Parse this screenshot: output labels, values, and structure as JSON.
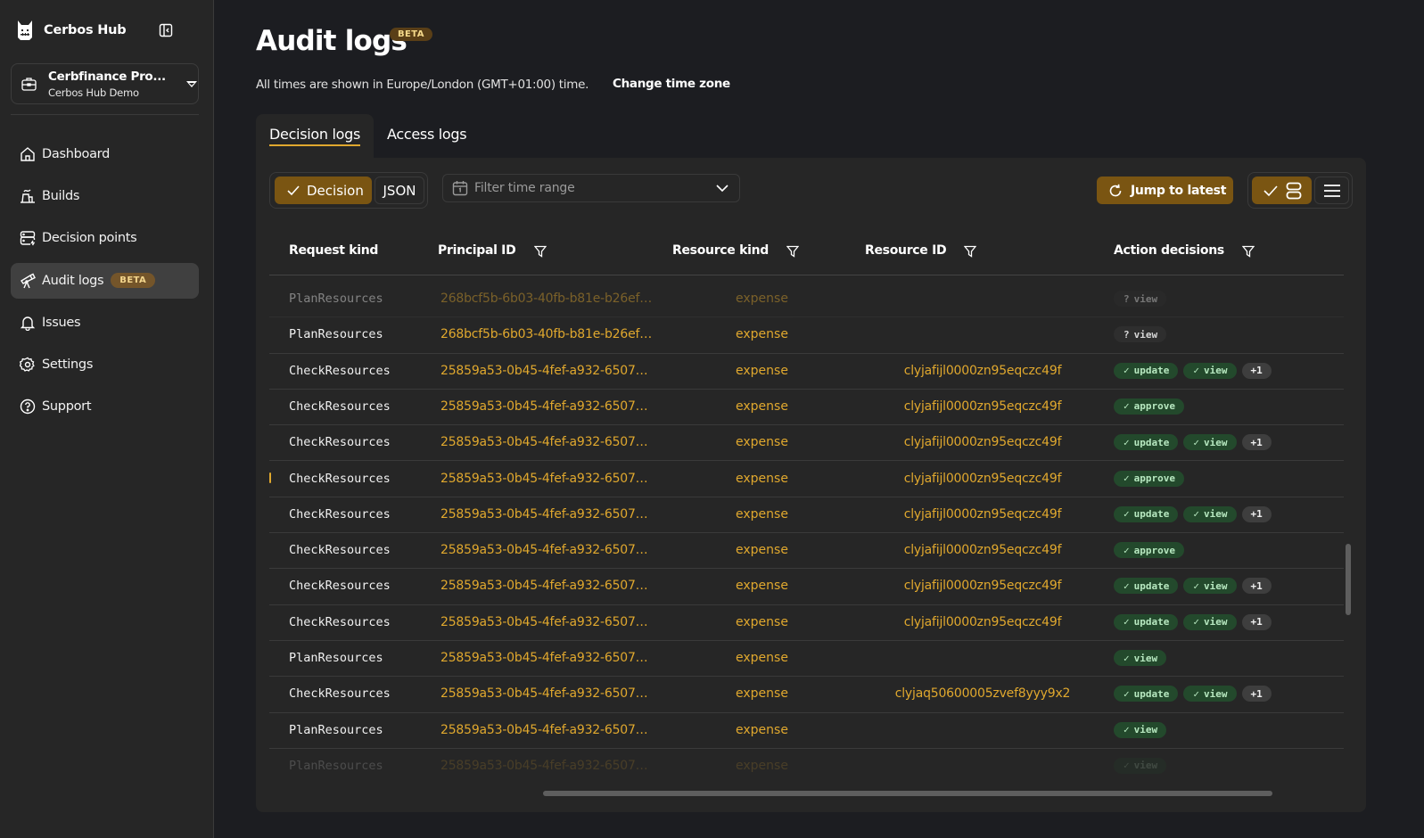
{
  "sidebar": {
    "brand": "Cerbos Hub",
    "org": {
      "name": "Cerbfinance Pro...",
      "sub": "Cerbos Hub Demo"
    },
    "items": [
      {
        "label": "Dashboard",
        "icon": "home-icon"
      },
      {
        "label": "Builds",
        "icon": "factory-icon"
      },
      {
        "label": "Decision points",
        "icon": "server-icon"
      },
      {
        "label": "Audit logs",
        "icon": "telescope-icon",
        "badge": "BETA",
        "active": true
      },
      {
        "label": "Issues",
        "icon": "bell-icon"
      },
      {
        "label": "Settings",
        "icon": "gear-icon"
      },
      {
        "label": "Support",
        "icon": "help-circle-icon"
      }
    ]
  },
  "header": {
    "title": "Audit logs",
    "badge": "BETA",
    "timezone_text": "All times are shown in Europe/London (GMT+01:00) time.",
    "change_timezone": "Change time zone"
  },
  "tabs": [
    {
      "label": "Decision logs",
      "active": true
    },
    {
      "label": "Access logs",
      "active": false
    }
  ],
  "toolbar": {
    "view_decision": "Decision",
    "view_json": "JSON",
    "time_filter_placeholder": "Filter time range",
    "jump_latest": "Jump to latest"
  },
  "colors": {
    "accent": "#e0a82e",
    "button_bg": "#7a5512",
    "allow_pill": "#23492c",
    "allow_text": "#b7e8c0"
  },
  "table": {
    "columns": [
      "Request kind",
      "Principal ID",
      "Resource kind",
      "Resource ID",
      "Action decisions"
    ],
    "rows": [
      {
        "kind": "PlanResources",
        "principal": "268bcf5b-6b03-40fb-b81e-b26ef…",
        "rkind": "expense",
        "rid": "",
        "actions": [
          {
            "t": "unknown",
            "label": "view"
          }
        ],
        "state": "faded"
      },
      {
        "kind": "PlanResources",
        "principal": "268bcf5b-6b03-40fb-b81e-b26ef…",
        "rkind": "expense",
        "rid": "",
        "actions": [
          {
            "t": "unknown",
            "label": "view"
          }
        ]
      },
      {
        "kind": "CheckResources",
        "principal": "25859a53-0b45-4fef-a932-6507…",
        "rkind": "expense",
        "rid": "clyjafijl0000zn95eqczc49f",
        "actions": [
          {
            "t": "allow",
            "label": "update"
          },
          {
            "t": "allow",
            "label": "view"
          },
          {
            "t": "more",
            "label": "+1"
          }
        ]
      },
      {
        "kind": "CheckResources",
        "principal": "25859a53-0b45-4fef-a932-6507…",
        "rkind": "expense",
        "rid": "clyjafijl0000zn95eqczc49f",
        "actions": [
          {
            "t": "allow",
            "label": "approve"
          }
        ]
      },
      {
        "kind": "CheckResources",
        "principal": "25859a53-0b45-4fef-a932-6507…",
        "rkind": "expense",
        "rid": "clyjafijl0000zn95eqczc49f",
        "actions": [
          {
            "t": "allow",
            "label": "update"
          },
          {
            "t": "allow",
            "label": "view"
          },
          {
            "t": "more",
            "label": "+1"
          }
        ]
      },
      {
        "kind": "CheckResources",
        "principal": "25859a53-0b45-4fef-a932-6507…",
        "rkind": "expense",
        "rid": "clyjafijl0000zn95eqczc49f",
        "actions": [
          {
            "t": "allow",
            "label": "approve"
          }
        ],
        "marker": true
      },
      {
        "kind": "CheckResources",
        "principal": "25859a53-0b45-4fef-a932-6507…",
        "rkind": "expense",
        "rid": "clyjafijl0000zn95eqczc49f",
        "actions": [
          {
            "t": "allow",
            "label": "update"
          },
          {
            "t": "allow",
            "label": "view"
          },
          {
            "t": "more",
            "label": "+1"
          }
        ]
      },
      {
        "kind": "CheckResources",
        "principal": "25859a53-0b45-4fef-a932-6507…",
        "rkind": "expense",
        "rid": "clyjafijl0000zn95eqczc49f",
        "actions": [
          {
            "t": "allow",
            "label": "approve"
          }
        ]
      },
      {
        "kind": "CheckResources",
        "principal": "25859a53-0b45-4fef-a932-6507…",
        "rkind": "expense",
        "rid": "clyjafijl0000zn95eqczc49f",
        "actions": [
          {
            "t": "allow",
            "label": "update"
          },
          {
            "t": "allow",
            "label": "view"
          },
          {
            "t": "more",
            "label": "+1"
          }
        ]
      },
      {
        "kind": "CheckResources",
        "principal": "25859a53-0b45-4fef-a932-6507…",
        "rkind": "expense",
        "rid": "clyjafijl0000zn95eqczc49f",
        "actions": [
          {
            "t": "allow",
            "label": "update"
          },
          {
            "t": "allow",
            "label": "view"
          },
          {
            "t": "more",
            "label": "+1"
          }
        ]
      },
      {
        "kind": "PlanResources",
        "principal": "25859a53-0b45-4fef-a932-6507…",
        "rkind": "expense",
        "rid": "",
        "actions": [
          {
            "t": "allow",
            "label": "view"
          }
        ]
      },
      {
        "kind": "CheckResources",
        "principal": "25859a53-0b45-4fef-a932-6507…",
        "rkind": "expense",
        "rid": "clyjaq50600005zvef8yyy9x2",
        "actions": [
          {
            "t": "allow",
            "label": "update"
          },
          {
            "t": "allow",
            "label": "view"
          },
          {
            "t": "more",
            "label": "+1"
          }
        ]
      },
      {
        "kind": "PlanResources",
        "principal": "25859a53-0b45-4fef-a932-6507…",
        "rkind": "expense",
        "rid": "",
        "actions": [
          {
            "t": "allow",
            "label": "view"
          }
        ]
      },
      {
        "kind": "PlanResources",
        "principal": "25859a53-0b45-4fef-a932-6507…",
        "rkind": "expense",
        "rid": "",
        "actions": [
          {
            "t": "allow",
            "label": "view"
          }
        ],
        "state": "fade-bottom"
      }
    ]
  }
}
